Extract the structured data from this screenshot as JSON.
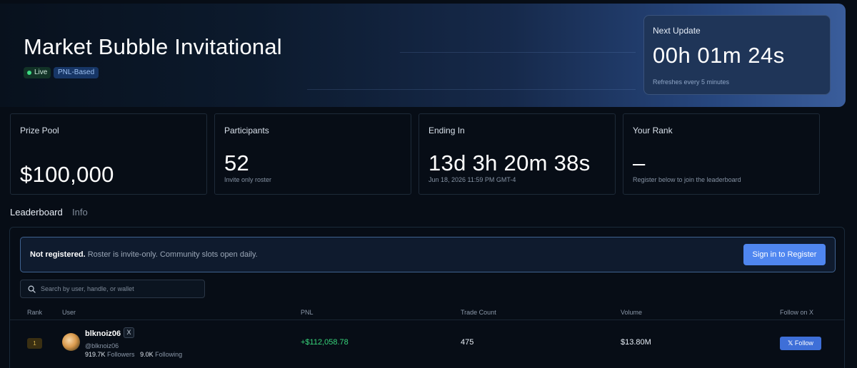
{
  "hero": {
    "title": "Market Bubble Invitational",
    "badges": {
      "live": "Live",
      "type": "PNL-Based"
    },
    "next_update": {
      "label": "Next Update",
      "countdown": "00h 01m 24s",
      "sub": "Refreshes every 5 minutes"
    }
  },
  "stats": [
    {
      "label": "Prize Pool",
      "value": "$100,000",
      "sub": ""
    },
    {
      "label": "Participants",
      "value": "52",
      "sub": "Invite only roster"
    },
    {
      "label": "Ending In",
      "value": "13d 3h 20m 38s",
      "sub": "Jun 18, 2026 11:59 PM GMT-4"
    },
    {
      "label": "Your Rank",
      "value": "–",
      "sub": "Register below to join the leaderboard"
    }
  ],
  "tabs": {
    "leaderboard": "Leaderboard",
    "info": "Info"
  },
  "banner": {
    "strong": "Not registered.",
    "text": " Roster is invite-only. Community slots open daily.",
    "button": "Sign in to Register"
  },
  "search": {
    "placeholder": "Search by user, handle, or wallet"
  },
  "table": {
    "headers": {
      "rank": "Rank",
      "user": "User",
      "pnl": "PNL",
      "trades": "Trade Count",
      "volume": "Volume",
      "follow": "Follow on X"
    },
    "rows": [
      {
        "rank": "1",
        "name": "blknoiz06",
        "x_icon": "X",
        "handle": "@blknoiz06",
        "followers_count": "919.7K",
        "followers_label": "Followers",
        "following_count": "9.0K",
        "following_label": "Following",
        "pnl": "+$112,058.78",
        "trades": "475",
        "volume": "$13.80M",
        "follow_label": "Follow"
      }
    ]
  },
  "colors": {
    "accent": "#4f86f0",
    "positive": "#37d37a",
    "live": "#3ddc84",
    "gold": "#d6b24a"
  }
}
